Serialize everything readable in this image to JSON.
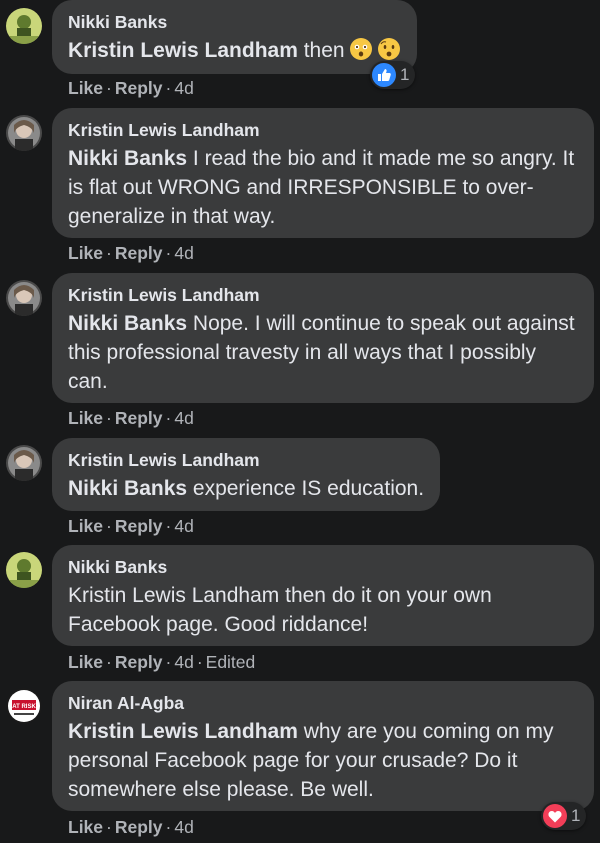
{
  "comments": [
    {
      "author": "Nikki Banks",
      "mention": "Kristin Lewis Landham",
      "text": " then",
      "actions": {
        "like": "Like",
        "reply": "Reply",
        "time": "4d"
      },
      "reaction": {
        "icon": "like-icon",
        "count": "1",
        "color": "#2d88ff"
      }
    },
    {
      "author": "Kristin Lewis Landham",
      "mention": "Nikki Banks",
      "text": " I read the bio and it made me so angry. It is flat out WRONG and IRRESPONSIBLE to over-generalize in that way.",
      "actions": {
        "like": "Like",
        "reply": "Reply",
        "time": "4d"
      }
    },
    {
      "author": "Kristin Lewis Landham",
      "mention": "Nikki Banks",
      "text": " Nope. I will continue to speak out against this professional travesty in all ways that I possibly can.",
      "actions": {
        "like": "Like",
        "reply": "Reply",
        "time": "4d"
      }
    },
    {
      "author": "Kristin Lewis Landham",
      "mention": "Nikki Banks",
      "text": " experience IS education.",
      "actions": {
        "like": "Like",
        "reply": "Reply",
        "time": "4d"
      }
    },
    {
      "author": "Nikki Banks",
      "mention": "",
      "text": "Kristin Lewis Landham then do it on your own Facebook page. Good riddance!",
      "actions": {
        "like": "Like",
        "reply": "Reply",
        "time": "4d",
        "edited": "Edited"
      }
    },
    {
      "author": "Niran Al-Agba",
      "mention": "Kristin Lewis Landham",
      "text": " why are you coming on my personal Facebook page for your crusade? Do it somewhere else please. Be well.",
      "actions": {
        "like": "Like",
        "reply": "Reply",
        "time": "4d"
      },
      "reaction": {
        "icon": "heart-icon",
        "count": "1",
        "color": "#f33e58"
      }
    }
  ],
  "avatar_badge_text": "AT RISK",
  "separator": "·"
}
